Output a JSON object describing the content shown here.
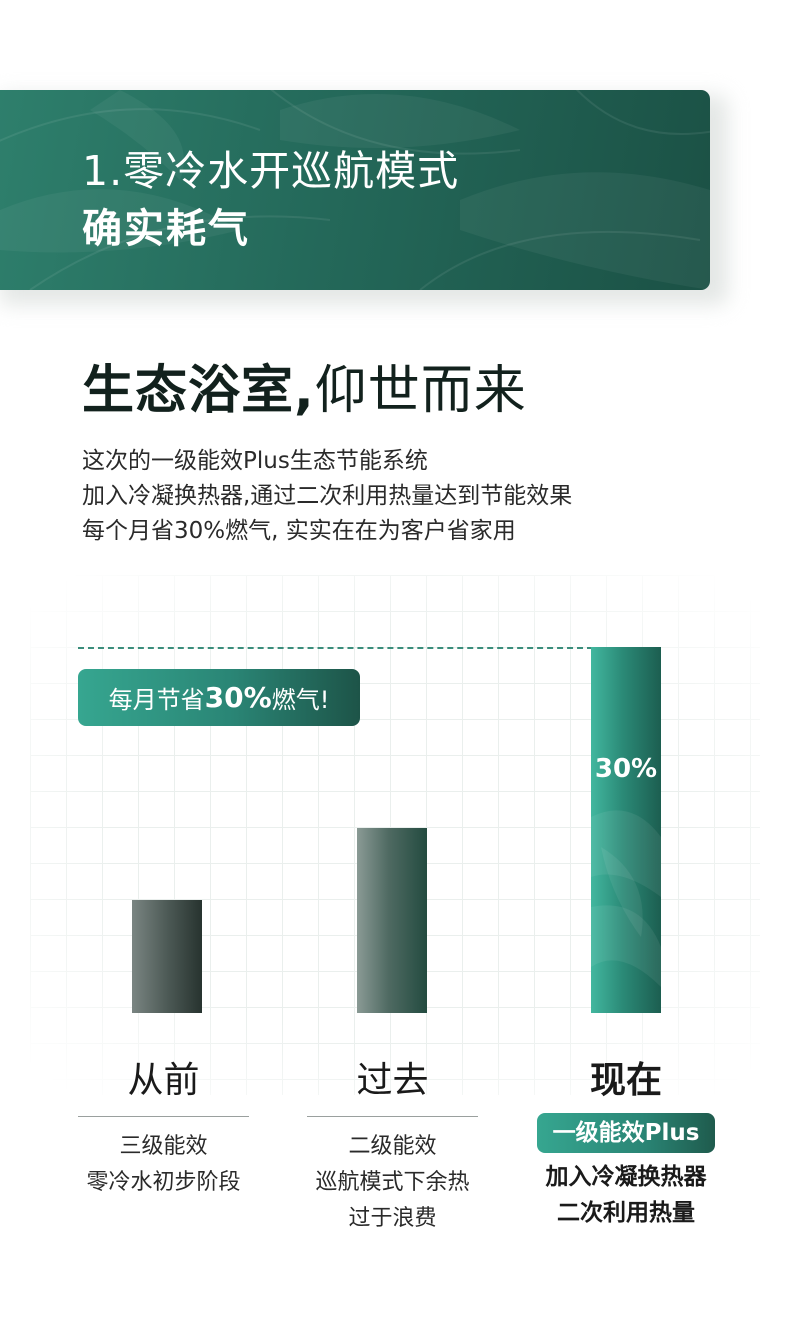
{
  "banner": {
    "title": "1.零冷水开巡航模式",
    "subtitle": "确实耗气"
  },
  "headline": {
    "bold_part": "生态浴室,",
    "light_part": "仰世而来"
  },
  "description": [
    "这次的一级能效Plus生态节能系统",
    "加入冷凝换热器,通过二次利用热量达到节能效果",
    "每个月省30%燃气, 实实在在为客户省家用"
  ],
  "chart_data": {
    "type": "bar",
    "categories": [
      "从前",
      "过去",
      "现在"
    ],
    "values": [
      35,
      57,
      113
    ],
    "value_label": "30%",
    "callout": {
      "prefix": "每月节省",
      "emphasis": "30%",
      "suffix": "燃气!"
    }
  },
  "columns": [
    {
      "title": "从前",
      "lines": [
        "三级能效",
        "零冷水初步阶段"
      ]
    },
    {
      "title": "过去",
      "lines": [
        "二级能效",
        "巡航模式下余热",
        "过于浪费"
      ]
    },
    {
      "title": "现在",
      "badge": "一级能效Plus",
      "lines": [
        "加入冷凝换热器",
        "二次利用热量"
      ]
    }
  ],
  "colors": {
    "brand_green": "#2a8575",
    "dark_green": "#1b5145",
    "gray_bar": "#4d5a56"
  }
}
